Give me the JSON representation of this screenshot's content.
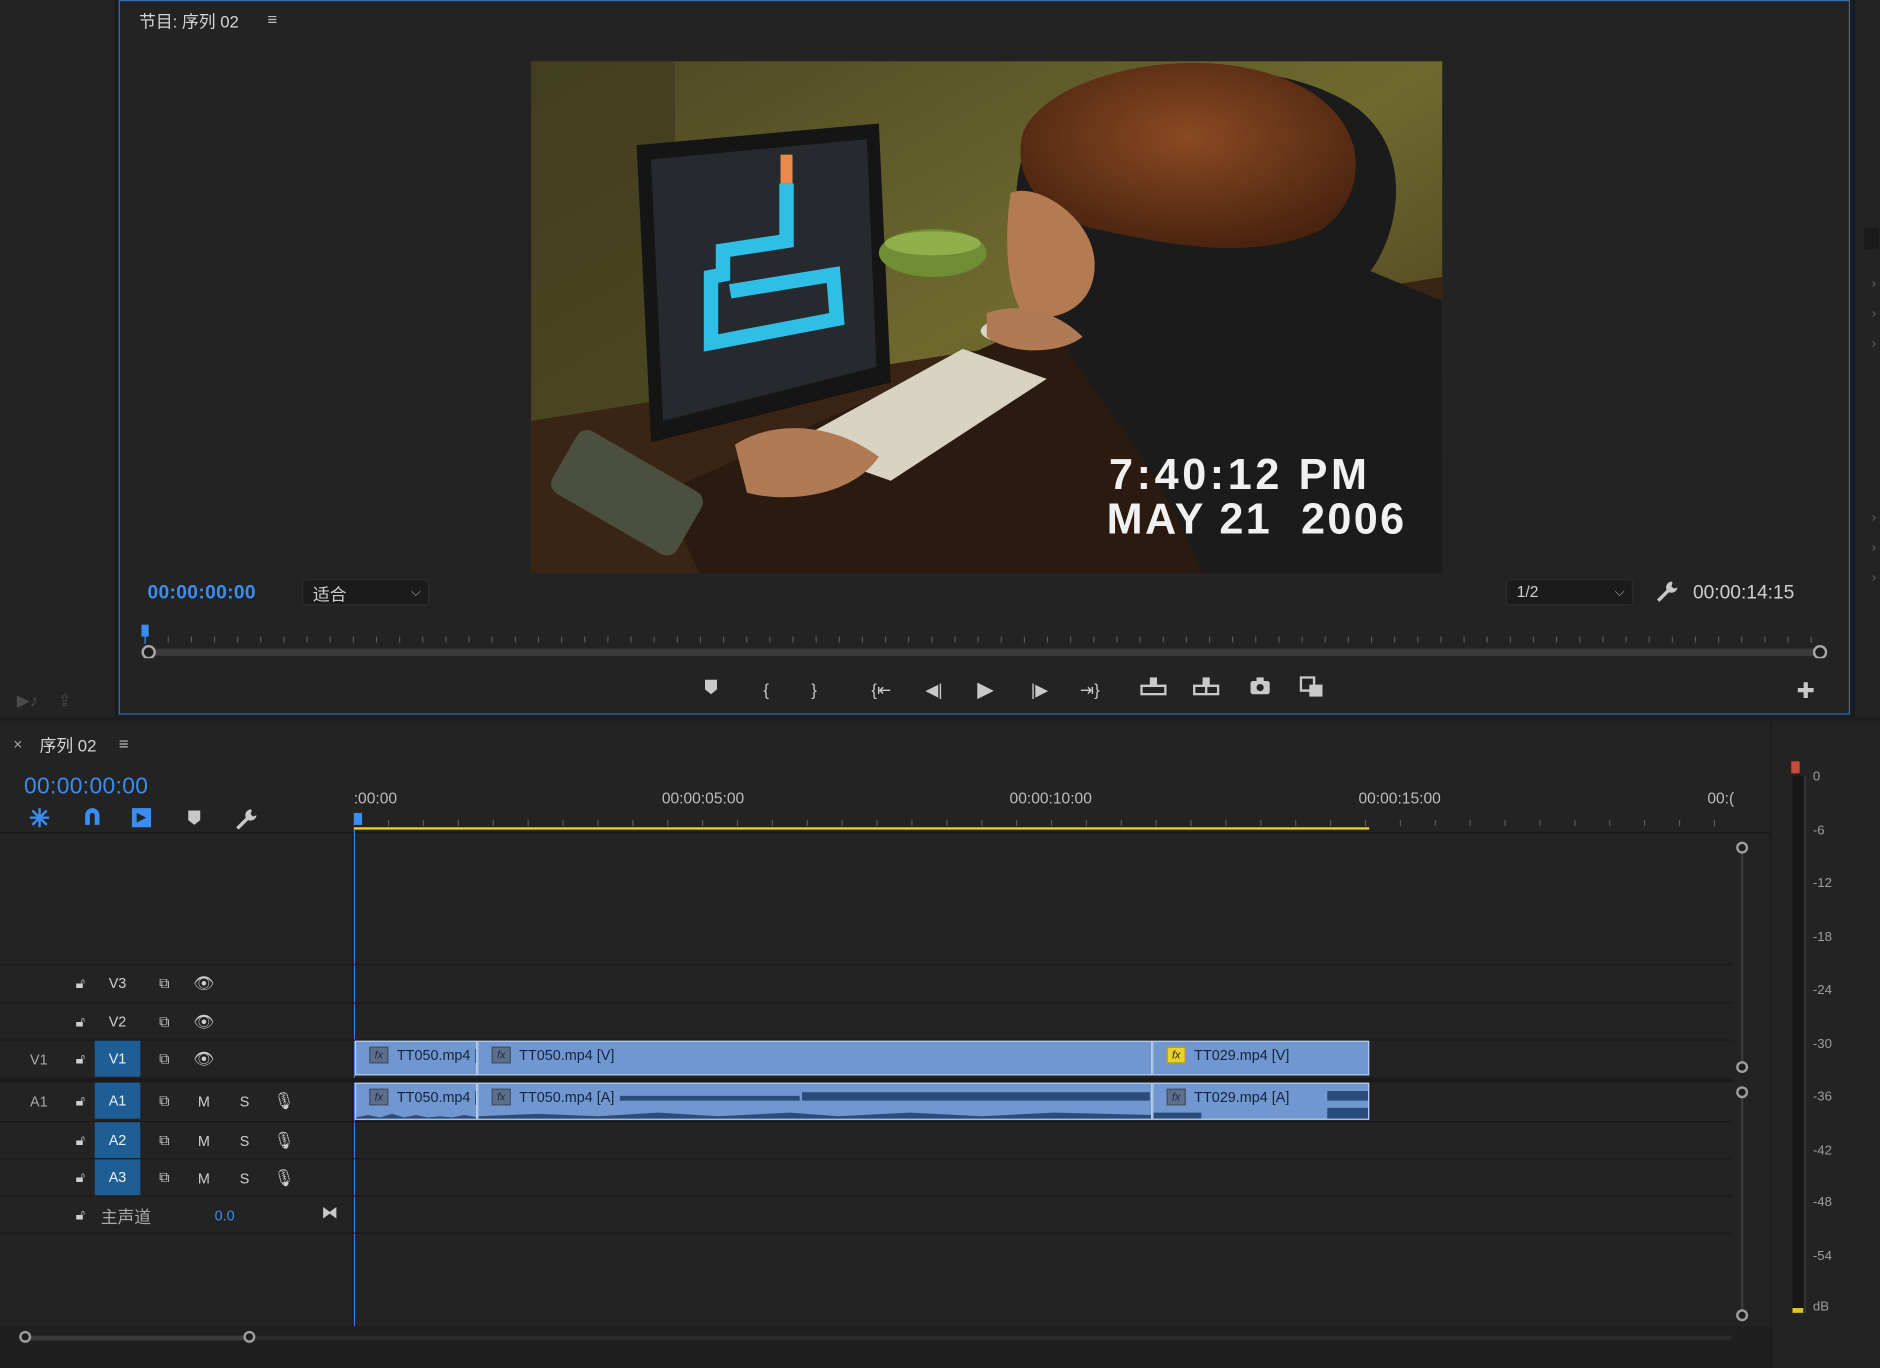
{
  "program_monitor": {
    "title": "节目: 序列 02",
    "menu_glyph": "≡",
    "current_timecode": "00:00:00:00",
    "fit_option": "适合",
    "resolution": "1/2",
    "duration": "00:00:14:15",
    "video_overlay": {
      "time": "7:40:12 PM",
      "date": "MAY 21  2006"
    }
  },
  "timeline": {
    "title": "序列 02",
    "close_glyph": "×",
    "menu_glyph": "≡",
    "current_timecode": "00:00:00:00",
    "ruler": [
      ":00:00",
      "00:00:05:00",
      "00:00:10:00",
      "00:00:15:00",
      "00:("
    ],
    "tracks": {
      "v3": {
        "name": "V3"
      },
      "v2": {
        "name": "V2"
      },
      "v1": {
        "source": "V1",
        "name": "V1"
      },
      "a1": {
        "source": "A1",
        "name": "A1",
        "mute": "M",
        "solo": "S"
      },
      "a2": {
        "name": "A2",
        "mute": "M",
        "solo": "S"
      },
      "a3": {
        "name": "A3",
        "mute": "M",
        "solo": "S"
      },
      "master": {
        "name": "主声道",
        "value": "0.0"
      }
    },
    "clips": {
      "video": [
        "TT050.mp4 [",
        "TT050.mp4 [V]",
        "TT029.mp4 [V]"
      ],
      "audio": [
        "TT050.mp4 [",
        "TT050.mp4 [A]",
        "TT029.mp4 [A]"
      ],
      "fx_badge": "fx"
    }
  },
  "audio_meter": {
    "scale": [
      "0",
      "-6",
      "-12",
      "-18",
      "-24",
      "-30",
      "-36",
      "-42",
      "-48",
      "-54",
      "dB"
    ]
  },
  "colors": {
    "accent": "#3a8df2",
    "clip": "#7097cf",
    "active_track": "#1f5e95",
    "work_area": "#e8d228"
  }
}
